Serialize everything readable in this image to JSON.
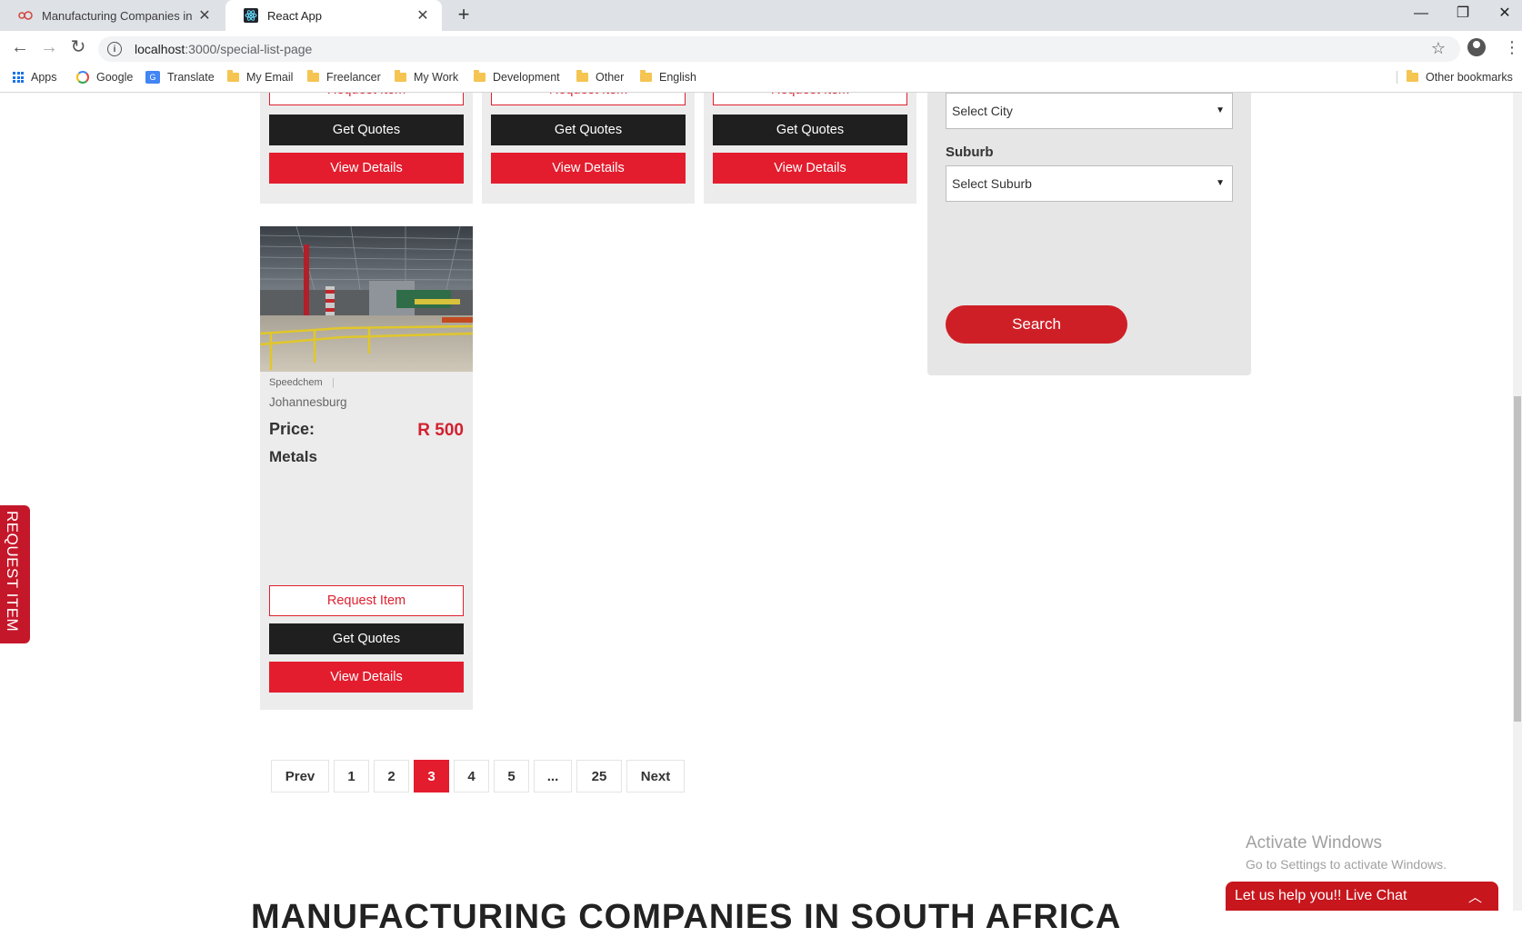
{
  "browser": {
    "tabs": [
      {
        "title": "Manufacturing Companies in Sou",
        "icon": "site-favicon"
      },
      {
        "title": "React App",
        "icon": "react-icon"
      }
    ],
    "url_host": "localhost",
    "url_path": ":3000/special-list-page",
    "bookmarks": [
      "Apps",
      "Google",
      "Translate",
      "My Email",
      "Freelancer",
      "My Work",
      "Development",
      "Other",
      "English"
    ],
    "other_bookmarks": "Other bookmarks"
  },
  "buttons": {
    "request_item": "Request Item",
    "get_quotes": "Get Quotes",
    "view_details": "View Details"
  },
  "sidebar": {
    "city_select": "Select City",
    "suburb_label": "Suburb",
    "suburb_select": "Select Suburb",
    "search_label": "Search"
  },
  "listing": {
    "company": "Speedchem",
    "location": "Johannesburg",
    "price_label": "Price:",
    "price_value": "R 500",
    "category": "Metals"
  },
  "pagination": {
    "items": [
      "Prev",
      "1",
      "2",
      "3",
      "4",
      "5",
      "...",
      "25",
      "Next"
    ],
    "active_page": "3"
  },
  "floating": {
    "request_tab": "REQUEST ITEM",
    "live_chat": "Let us help you!! Live Chat"
  },
  "watermark": {
    "line1": "Activate Windows",
    "line2": "Go to Settings to activate Windows."
  },
  "section_heading": "MANUFACTURING COMPANIES IN SOUTH AFRICA",
  "colors": {
    "accent_red": "#e31d2e",
    "dark_button": "#1f1f1f",
    "card_bg": "#ececec"
  }
}
